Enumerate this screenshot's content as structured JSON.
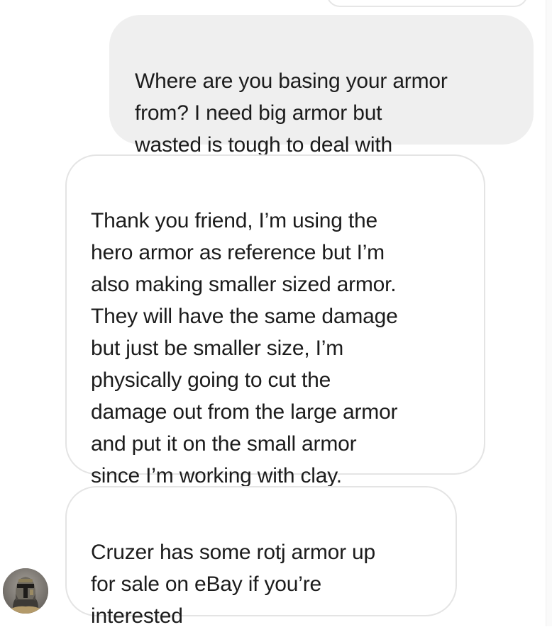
{
  "conversation": {
    "messages": [
      {
        "direction": "sent",
        "text": "Where are you basing your armor\nfrom? I need big armor but\nwasted is tough to deal with"
      },
      {
        "direction": "received",
        "text": "Thank you friend, I’m using the\nhero armor as reference but I’m\nalso making smaller sized armor.\nThey will have the same damage\nbut just be smaller size, I’m\nphysically going to cut the\ndamage out from the large armor\nand put it on the small armor\nsince I’m working with clay."
      },
      {
        "direction": "received",
        "text": "Cruzer has some rotj armor up\nfor sale on eBay if you’re\ninterested"
      }
    ],
    "avatar_icon": "helmet-avatar-icon"
  },
  "colors": {
    "sent_bubble": "#efefef",
    "received_border": "#e4e4e4",
    "text": "#1c1c1c",
    "background": "#ffffff"
  }
}
